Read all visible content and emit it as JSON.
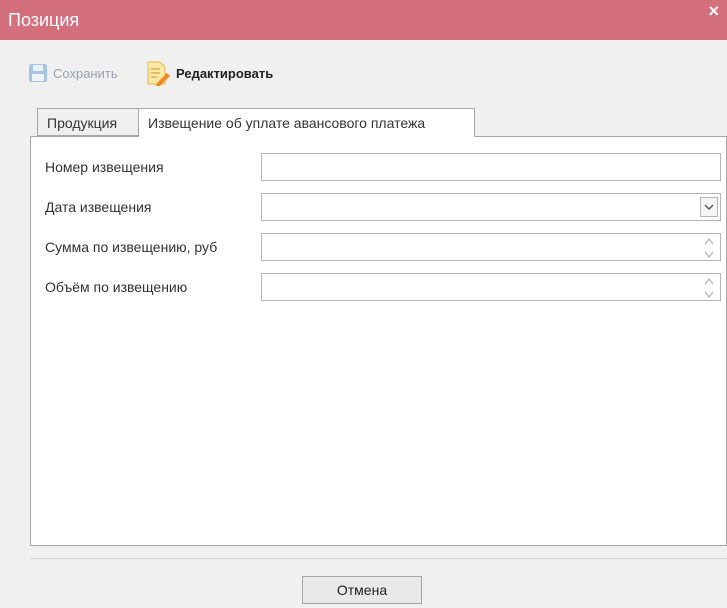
{
  "window": {
    "title": "Позиция",
    "close_glyph": "×"
  },
  "toolbar": {
    "save_label": "Сохранить",
    "save_icon": "floppy-disk-icon",
    "edit_label": "Редактировать",
    "edit_icon": "document-edit-icon"
  },
  "tabs": [
    {
      "label": "Продукция",
      "active": false
    },
    {
      "label": "Извещение об уплате авансового платежа",
      "active": true
    }
  ],
  "form": {
    "notice_number": {
      "label": "Номер извещения",
      "value": ""
    },
    "notice_date": {
      "label": "Дата извещения",
      "value": ""
    },
    "notice_sum": {
      "label": "Сумма по извещению, руб",
      "value": ""
    },
    "notice_volume": {
      "label": "Объём по извещению",
      "value": ""
    }
  },
  "footer": {
    "cancel_label": "Отмена"
  },
  "colors": {
    "titlebar": "#d4707e",
    "background": "#f0f0f0"
  }
}
